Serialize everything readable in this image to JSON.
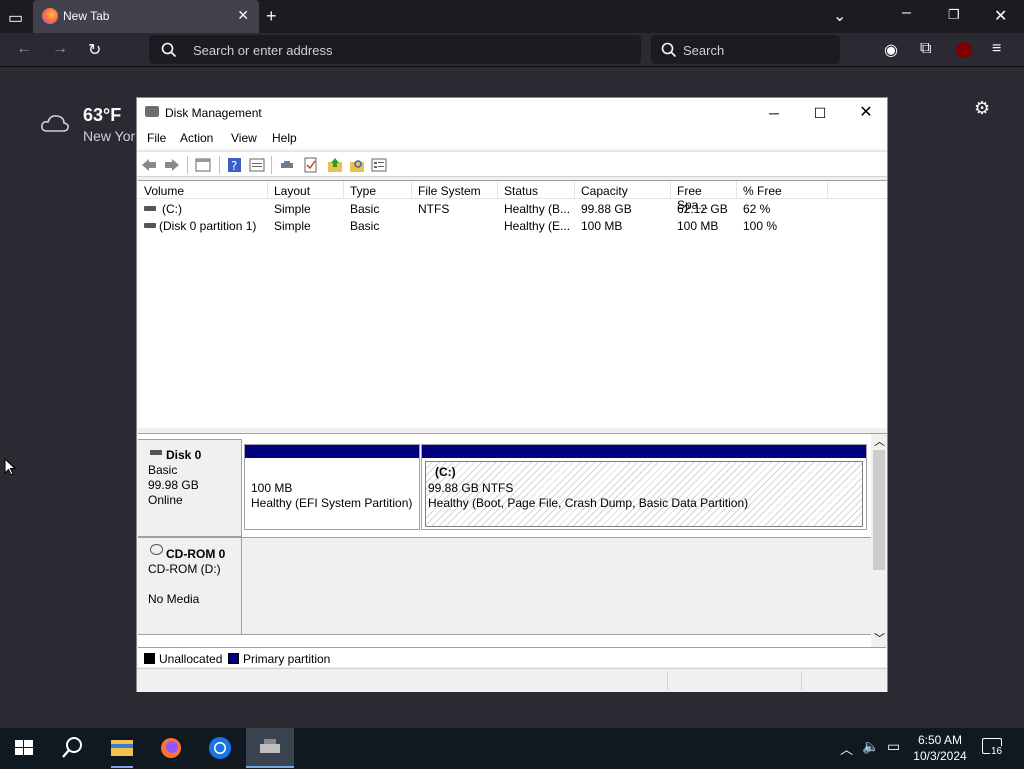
{
  "browser": {
    "tab_title": "New Tab",
    "url_placeholder": "Search or enter address",
    "search_placeholder": "Search"
  },
  "weather": {
    "temp": "63°F",
    "location": "New Yor"
  },
  "window": {
    "title": "Disk Management",
    "menu": [
      "File",
      "Action",
      "View",
      "Help"
    ]
  },
  "volume_list": {
    "columns": [
      "Volume",
      "Layout",
      "Type",
      "File System",
      "Status",
      "Capacity",
      "Free Spa...",
      "% Free"
    ],
    "rows": [
      [
        "(C:)",
        "Simple",
        "Basic",
        "NTFS",
        "Healthy (B...",
        "99.88 GB",
        "62.12 GB",
        "62 %"
      ],
      [
        "(Disk 0 partition 1)",
        "Simple",
        "Basic",
        "",
        "Healthy (E...",
        "100 MB",
        "100 MB",
        "100 %"
      ]
    ]
  },
  "disks": {
    "disk0": {
      "name": "Disk 0",
      "type": "Basic",
      "size": "99.98 GB",
      "state": "Online",
      "partitions": [
        {
          "line1": "100 MB",
          "line2": "Healthy (EFI System Partition)"
        },
        {
          "label": "(C:)",
          "line1": "99.88 GB NTFS",
          "line2": "Healthy (Boot, Page File, Crash Dump, Basic Data Partition)"
        }
      ]
    },
    "cdrom0": {
      "name": "CD-ROM 0",
      "type": "CD-ROM (D:)",
      "media": "No Media"
    }
  },
  "legend": {
    "unallocated": "Unallocated",
    "primary": "Primary partition"
  },
  "colors": {
    "partition_header": "#000080",
    "unallocated": "#000000",
    "primary": "#000080"
  },
  "taskbar": {
    "time": "6:50 AM",
    "date": "10/3/2024",
    "notifications": "16"
  }
}
